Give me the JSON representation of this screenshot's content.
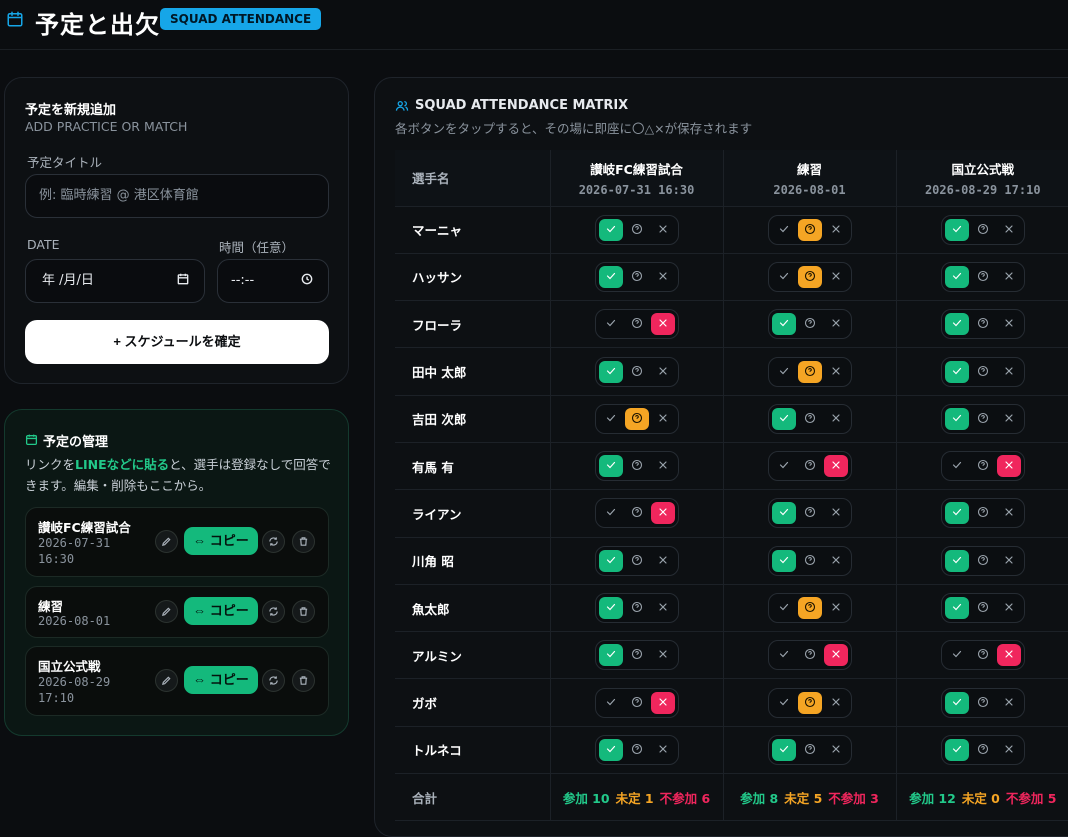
{
  "header": {
    "title": "予定と出欠",
    "badge": "SQUAD ATTENDANCE",
    "accent": "#16a6e8"
  },
  "add_form": {
    "title": "予定を新規追加",
    "subtitle": "ADD PRACTICE OR MATCH",
    "title_label": "予定タイトル",
    "title_placeholder": "例: 臨時練習 @ 港区体育館",
    "date_label": "DATE",
    "date_value": "年 /月/日",
    "time_label": "時間（任意）",
    "time_value": "--:--",
    "submit_label": "+ スケジュールを確定"
  },
  "manage": {
    "title": "予定の管理",
    "desc_pre": "リンクを",
    "desc_highlight": "LINEなどに貼る",
    "desc_post": "と、選手は登録なしで回答できます。編集・削除もここから。",
    "copy_label": "コピー",
    "events": [
      {
        "name": "讃岐FC練習試合",
        "date": "2026-07-31 16:30"
      },
      {
        "name": "練習",
        "date": "2026-08-01"
      },
      {
        "name": "国立公式戦",
        "date": "2026-08-29 17:10"
      }
    ]
  },
  "matrix": {
    "title": "SQUAD ATTENDANCE MATRIX",
    "subtitle": "各ボタンをタップすると、その場に即座に〇△×が保存されます",
    "player_header": "選手名",
    "events": [
      {
        "name": "讃岐FC練習試合",
        "date": "2026-07-31 16:30"
      },
      {
        "name": "練習",
        "date": "2026-08-01"
      },
      {
        "name": "国立公式戦",
        "date": "2026-08-29 17:10"
      }
    ],
    "players": [
      {
        "name": "マーニャ",
        "status": [
          "ok",
          "maybe",
          "ok"
        ]
      },
      {
        "name": "ハッサン",
        "status": [
          "ok",
          "maybe",
          "ok"
        ]
      },
      {
        "name": "フローラ",
        "status": [
          "no",
          "ok",
          "ok"
        ]
      },
      {
        "name": "田中 太郎",
        "status": [
          "ok",
          "maybe",
          "ok"
        ]
      },
      {
        "name": "吉田 次郎",
        "status": [
          "maybe",
          "ok",
          "ok"
        ]
      },
      {
        "name": "有馬 有",
        "status": [
          "ok",
          "no",
          "no"
        ]
      },
      {
        "name": "ライアン",
        "status": [
          "no",
          "ok",
          "ok"
        ]
      },
      {
        "name": "川角 昭",
        "status": [
          "ok",
          "ok",
          "ok"
        ]
      },
      {
        "name": "魚太郎",
        "status": [
          "ok",
          "maybe",
          "ok"
        ]
      },
      {
        "name": "アルミン",
        "status": [
          "ok",
          "no",
          "no"
        ]
      },
      {
        "name": "ガボ",
        "status": [
          "no",
          "maybe",
          "ok"
        ]
      },
      {
        "name": "トルネコ",
        "status": [
          "ok",
          "ok",
          "ok"
        ]
      }
    ],
    "total_label": "合計",
    "totals": [
      {
        "attend": "参加 10",
        "maybe": "未定 1",
        "absent": "不参加 6"
      },
      {
        "attend": "参加 8",
        "maybe": "未定 5",
        "absent": "不参加 3"
      },
      {
        "attend": "参加 12",
        "maybe": "未定 0",
        "absent": "不参加 5"
      }
    ]
  },
  "colors": {
    "ok": "#14b97c",
    "maybe": "#f5a524",
    "no": "#f0265d"
  }
}
